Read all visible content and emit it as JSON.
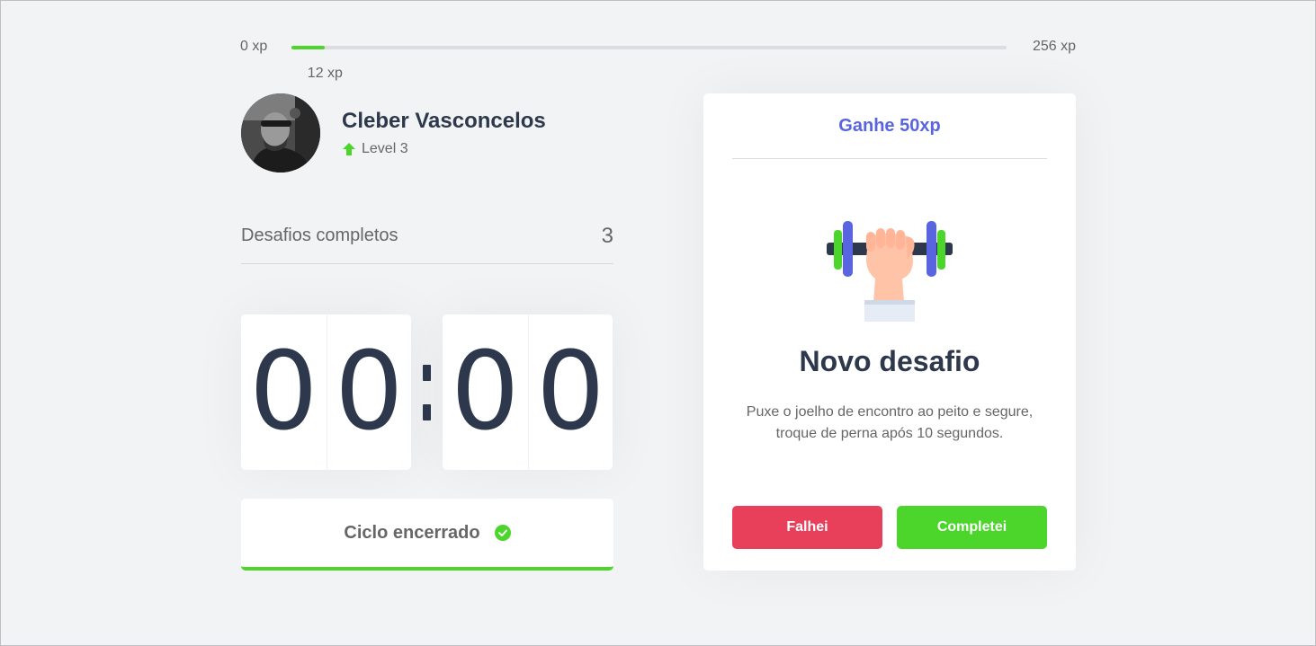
{
  "experience": {
    "min_label": "0 xp",
    "max_label": "256 xp",
    "current_label": "12 xp",
    "current_fraction": 0.047
  },
  "profile": {
    "name": "Cleber Vasconcelos",
    "level_label": "Level 3",
    "avatar_icon": "user-photo",
    "level_icon": "arrow-up-icon"
  },
  "completed_challenges": {
    "label": "Desafios completos",
    "count": "3"
  },
  "countdown": {
    "minute_left": "0",
    "minute_right": "0",
    "second_left": "0",
    "second_right": "0"
  },
  "cycle_button": {
    "label": "Ciclo encerrado",
    "icon": "check-circle-icon"
  },
  "challenge": {
    "header": "Ganhe 50xp",
    "image_icon": "dumbbell-icon",
    "title": "Novo desafio",
    "description": "Puxe o joelho de encontro ao peito e segure, troque de perna após 10 segundos.",
    "fail_label": "Falhei",
    "success_label": "Completei"
  },
  "colors": {
    "background": "#F2F3F5",
    "green": "#4CD62B",
    "red": "#E83F5B",
    "blue": "#5965E0",
    "title": "#2E384D",
    "text": "#666666"
  }
}
